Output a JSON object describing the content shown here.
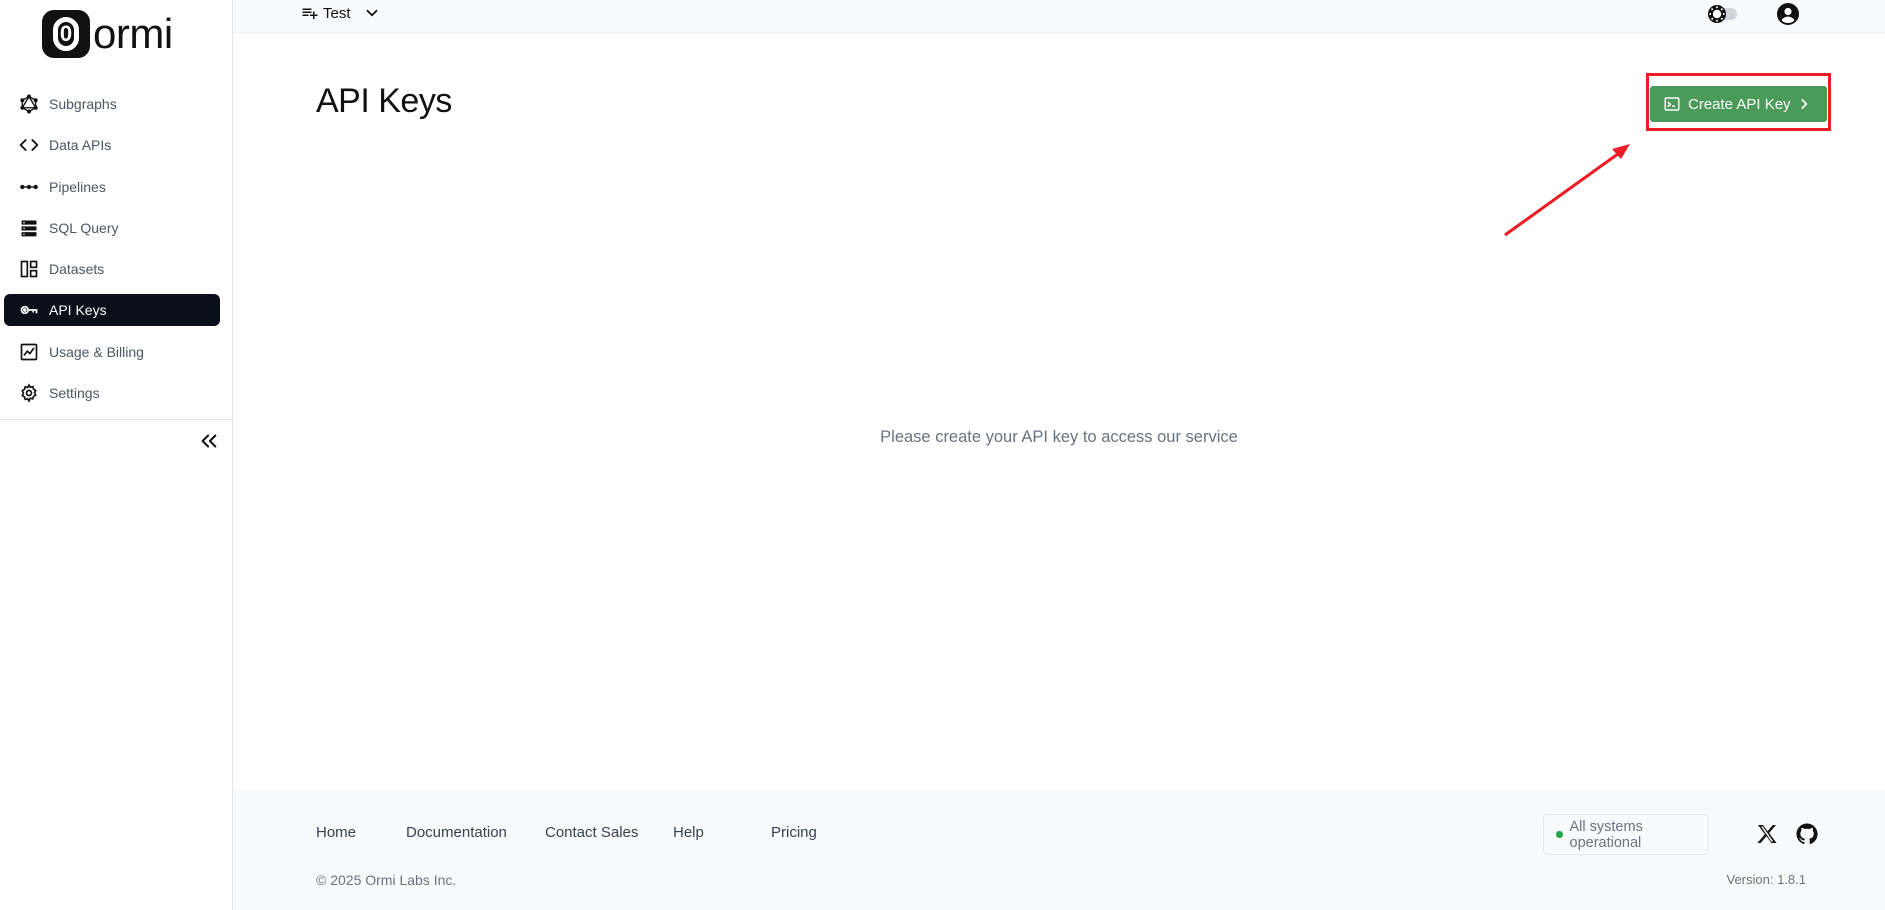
{
  "brand": {
    "logo_letter": "0",
    "name": "ormi"
  },
  "sidebar": {
    "items": [
      {
        "label": "Subgraphs",
        "icon": "graphql-icon",
        "active": false
      },
      {
        "label": "Data APIs",
        "icon": "code-brackets-icon",
        "active": false
      },
      {
        "label": "Pipelines",
        "icon": "pipeline-dots-icon",
        "active": false
      },
      {
        "label": "SQL Query",
        "icon": "database-stack-icon",
        "active": false
      },
      {
        "label": "Datasets",
        "icon": "dashboard-grid-icon",
        "active": false
      },
      {
        "label": "API Keys",
        "icon": "key-icon",
        "active": true
      },
      {
        "label": "Usage & Billing",
        "icon": "chart-line-icon",
        "active": false
      },
      {
        "label": "Settings",
        "icon": "gear-icon",
        "active": false
      }
    ],
    "collapse_icon": "double-chevron-left-icon"
  },
  "topbar": {
    "project_label": "Test",
    "project_icon": "playlist-add-icon",
    "dropdown_icon": "chevron-down-icon",
    "theme_icon": "theme-toggle-icon",
    "user_icon": "account-circle-icon"
  },
  "main": {
    "title": "API Keys",
    "create_button_label": "Create API Key",
    "empty_message": "Please create your API key to access our service"
  },
  "footer": {
    "links": [
      "Home",
      "Documentation",
      "Contact Sales",
      "Help",
      "Pricing"
    ],
    "copyright": "© 2025 Ormi Labs Inc.",
    "status": "All systems operational",
    "version": "Version: 1.8.1"
  },
  "colors": {
    "accent_green": "#4a9a5a",
    "active_nav_bg": "#0b0f1a",
    "annotation_red": "#ee1c25",
    "status_green": "#22a34a"
  }
}
